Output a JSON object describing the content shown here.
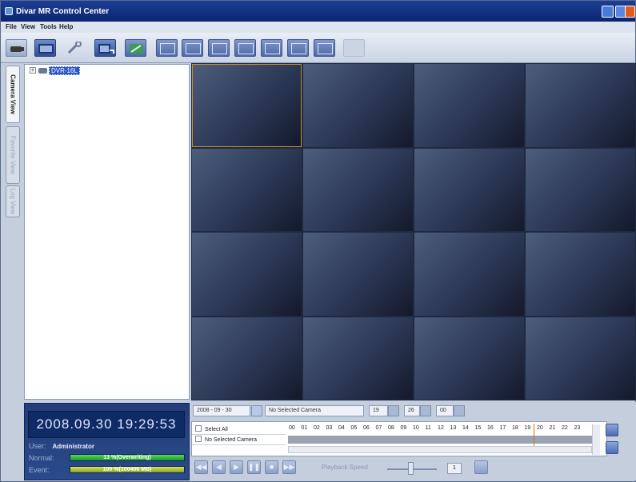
{
  "window": {
    "title": "Divar MR Control Center"
  },
  "menu": [
    "File",
    "View",
    "Tools",
    "Help"
  ],
  "toolbar": {
    "icons": [
      "camera-icon",
      "video-strip-icon",
      "wrench-icon",
      "video-export-icon",
      "signal-icon",
      "layout-1-icon",
      "layout-4-icon",
      "layout-6-icon",
      "layout-9-icon",
      "layout-8-icon",
      "layout-13-icon",
      "layout-16-icon",
      "layout-disabled-icon"
    ]
  },
  "side_tabs": [
    "Camera View",
    "Favorite View",
    "Log View"
  ],
  "tree": {
    "node": "DVR-16L"
  },
  "status": {
    "datetime": "2008.09.30  19:29:53",
    "user_label": "User:",
    "user_value": "Administrator",
    "normal_label": "Normal:",
    "normal_bar": "13 %(Overwriting)",
    "event_label": "Event:",
    "event_bar": "100 %(100406 MB)",
    "colors": {
      "normal": "#2aa835",
      "event": "#a9bb36"
    }
  },
  "playback": {
    "date": "2008 - 09 - 30",
    "camera": "No Selected Camera",
    "hour": "19",
    "minute": "26",
    "second": "00",
    "rows": [
      "Select All",
      "No Selected Camera"
    ],
    "hours": [
      "00",
      "01",
      "02",
      "03",
      "04",
      "05",
      "06",
      "07",
      "08",
      "09",
      "10",
      "11",
      "12",
      "13",
      "14",
      "15",
      "16",
      "17",
      "18",
      "19",
      "20",
      "21",
      "22",
      "23"
    ],
    "speed_label": "Playback Speed",
    "speed_value": "1"
  }
}
